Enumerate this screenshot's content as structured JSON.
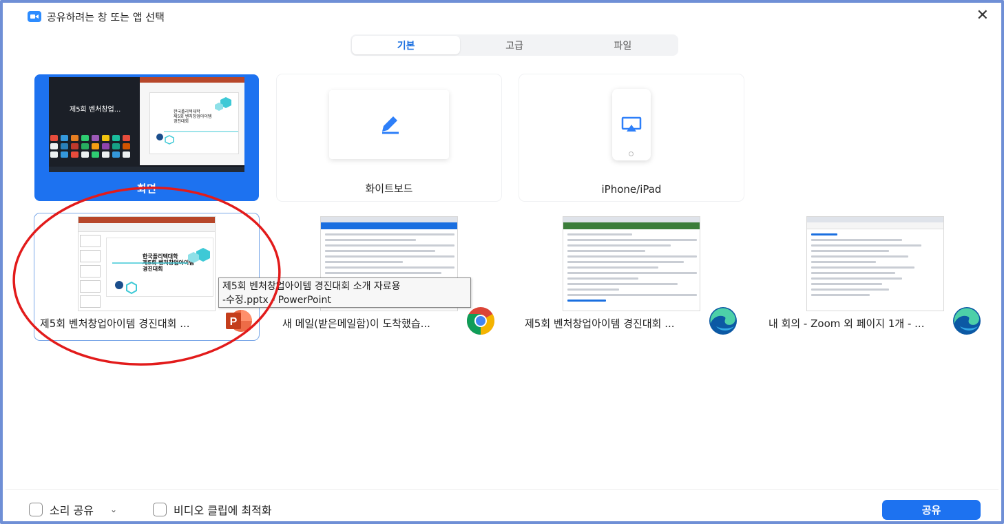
{
  "window": {
    "title": "공유하려는 창 또는 앱 선택",
    "close_glyph": "✕"
  },
  "tabs": [
    {
      "label": "기본",
      "active": true
    },
    {
      "label": "고급",
      "active": false
    },
    {
      "label": "파일",
      "active": false
    }
  ],
  "top_cards": {
    "screen": {
      "label": "화면",
      "preview_text": "제5회 벤처창업...",
      "slide_text": "한국폴리텍대학\n제5회 벤처창업아이템\n경진대회"
    },
    "whiteboard": {
      "label": "화이트보드"
    },
    "ipad": {
      "label": "iPhone/iPad"
    }
  },
  "windows": [
    {
      "label": "제5회 벤처창업아이템 경진대회 ...",
      "app": "PowerPoint",
      "app_icon": "powerpoint-icon",
      "slide_text": "한국폴리텍대학\n제5회 벤처창업아이템\n경진대회"
    },
    {
      "label": "새 메일(받은메일함)이 도착했습...",
      "app": "Chrome",
      "app_icon": "chrome-icon"
    },
    {
      "label": "제5회 벤처창업아이템 경진대회 ...",
      "app": "Edge",
      "app_icon": "edge-icon"
    },
    {
      "label": "내 회의 - Zoom 외 페이지 1개 - ...",
      "app": "Edge",
      "app_icon": "edge-icon"
    }
  ],
  "tooltip": {
    "line1": "제5회 벤처창업아이템 경진대회 소개 자료용",
    "line2": "-수정.pptx - PowerPoint"
  },
  "footer": {
    "share_sound": "소리 공유",
    "optimize_video": "비디오 클립에 최적화",
    "share_button": "공유"
  },
  "colors": {
    "accent": "#1d72f0",
    "frame": "#6f8fd6",
    "annotation": "#e21b1b",
    "powerpoint": "#d04423"
  }
}
